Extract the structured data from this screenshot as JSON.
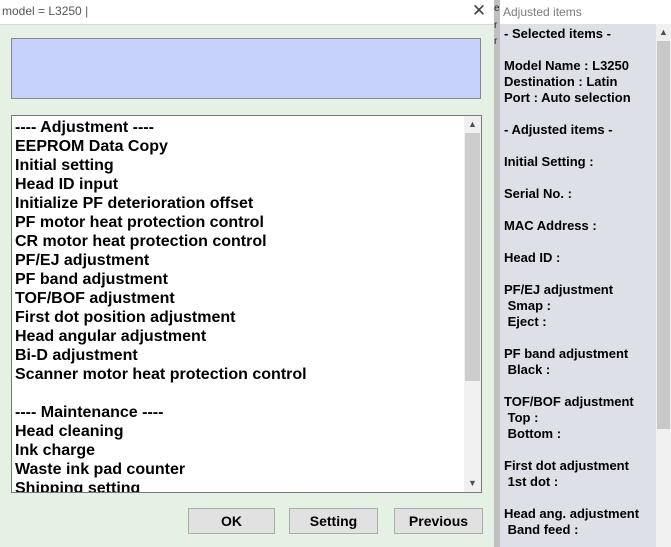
{
  "dialog": {
    "title": "model = L3250 |",
    "close_glyph": "✕",
    "list_items": [
      "---- Adjustment ----",
      "EEPROM Data Copy",
      "Initial setting",
      "Head ID input",
      "Initialize PF deterioration offset",
      "PF motor heat protection control",
      "CR motor heat protection control",
      "PF/EJ adjustment",
      "PF band adjustment",
      "TOF/BOF adjustment",
      "First dot position adjustment",
      "Head angular adjustment",
      "Bi-D adjustment",
      "Scanner motor heat protection control",
      "",
      "---- Maintenance ----",
      "Head cleaning",
      "Ink charge",
      "Waste ink pad counter",
      "Shipping setting"
    ],
    "scroll_up_glyph": "▲",
    "scroll_down_glyph": "▼",
    "buttons": {
      "ok": "OK",
      "setting": "Setting",
      "previous": "Previous"
    }
  },
  "divider": {
    "marks": [
      "e",
      "r",
      "r"
    ]
  },
  "adjusted": {
    "title": "Adjusted items",
    "scroll_up_glyph": "▲",
    "lines": [
      "- Selected items -",
      "Model Name : L3250",
      "Destination : Latin",
      "Port : Auto selection",
      "- Adjusted items -",
      "Initial Setting :",
      "Serial No. :",
      "MAC Address :",
      "Head ID :",
      "PF/EJ adjustment",
      " Smap :",
      " Eject :",
      "PF band adjustment",
      " Black :",
      "TOF/BOF adjustment",
      " Top :",
      " Bottom :",
      "First dot adjustment",
      " 1st dot :",
      "Head ang. adjustment",
      " Band feed :"
    ]
  }
}
